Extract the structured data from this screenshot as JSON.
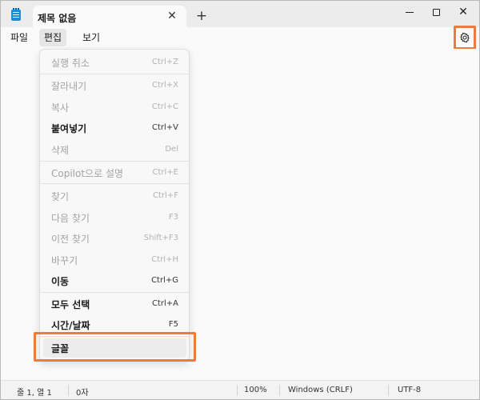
{
  "titlebar": {
    "tab_title": "제목 없음",
    "close_glyph": "✕",
    "new_tab_glyph": "+",
    "close_window_glyph": "✕",
    "icons": {
      "app": "notepad-icon",
      "close_tab": "close-icon",
      "new_tab": "plus-icon",
      "minimize": "minimize-icon",
      "maximize": "maximize-icon",
      "close_window": "close-icon"
    }
  },
  "menubar": {
    "file": "파일",
    "edit": "편집",
    "view": "보기",
    "settings_icon": "gear-icon"
  },
  "edit_menu": {
    "items": [
      {
        "label": "실행 취소",
        "shortcut": "Ctrl+Z",
        "enabled": false
      },
      {
        "label": "잘라내기",
        "shortcut": "Ctrl+X",
        "enabled": false
      },
      {
        "label": "복사",
        "shortcut": "Ctrl+C",
        "enabled": false
      },
      {
        "label": "붙여넣기",
        "shortcut": "Ctrl+V",
        "enabled": true
      },
      {
        "label": "삭제",
        "shortcut": "Del",
        "enabled": false
      },
      {
        "label": "Copilot으로 설명",
        "shortcut": "Ctrl+E",
        "enabled": false
      },
      {
        "label": "찾기",
        "shortcut": "Ctrl+F",
        "enabled": false
      },
      {
        "label": "다음 찾기",
        "shortcut": "F3",
        "enabled": false
      },
      {
        "label": "이전 찾기",
        "shortcut": "Shift+F3",
        "enabled": false
      },
      {
        "label": "바꾸기",
        "shortcut": "Ctrl+H",
        "enabled": false
      },
      {
        "label": "이동",
        "shortcut": "Ctrl+G",
        "enabled": true
      },
      {
        "label": "모두 선택",
        "shortcut": "Ctrl+A",
        "enabled": true
      },
      {
        "label": "시간/날짜",
        "shortcut": "F5",
        "enabled": true
      },
      {
        "label": "글꼴",
        "shortcut": "",
        "enabled": true
      }
    ]
  },
  "statusbar": {
    "position": "줄 1, 열 1",
    "chars": "0자",
    "zoom": "100%",
    "line_ending": "Windows (CRLF)",
    "encoding": "UTF-8"
  },
  "colors": {
    "highlight": "#ec7b3c",
    "app_icon": "#1c8fd2"
  }
}
